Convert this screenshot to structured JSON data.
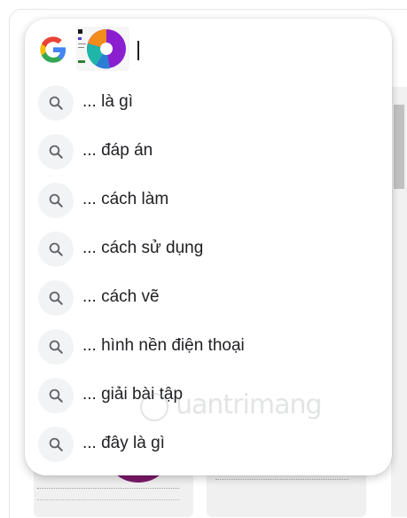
{
  "search": {
    "logo_icon": "google-g-icon",
    "thumbnail_icon": "image-thumbnail-pie-chart",
    "query": ""
  },
  "suggestions": [
    {
      "label": "... là gì"
    },
    {
      "label": "... đáp án"
    },
    {
      "label": "... cách làm"
    },
    {
      "label": "... cách sử dụng"
    },
    {
      "label": "... cách vẽ"
    },
    {
      "label": "... hình nền điện thoại"
    },
    {
      "label": "... giải bài tập"
    },
    {
      "label": "... đây là gì"
    }
  ],
  "suggestion_icon": "search-icon",
  "watermark": {
    "text": "uantrimang"
  },
  "colors": {
    "text": "#202124",
    "icon_bg": "#f1f3f4",
    "google_blue": "#4285F4",
    "google_red": "#EA4335",
    "google_yellow": "#FBBC05",
    "google_green": "#34A853"
  }
}
